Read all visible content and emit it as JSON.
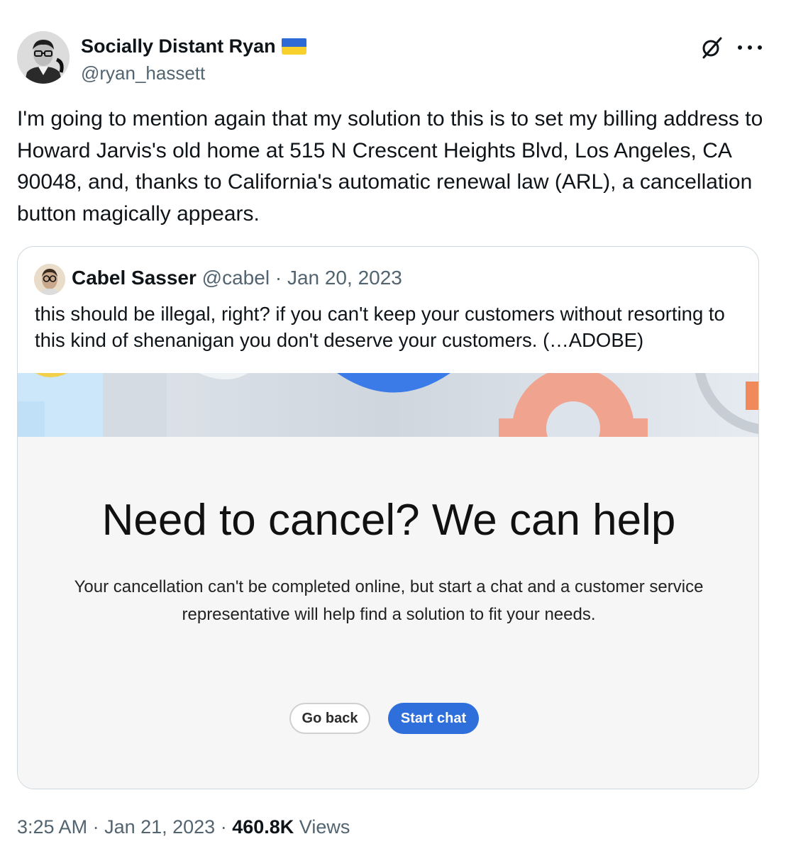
{
  "tweet": {
    "author": {
      "display_name": "Socially Distant Ryan",
      "handle": "@ryan_hassett",
      "flag_icon": "ukraine-flag-icon"
    },
    "text": "I'm going to mention again that my solution to this is to set my billing address to Howard Jarvis's old home at 515 N Crescent Heights Blvd, Los Angeles, CA 90048, and, thanks to California's automatic renewal law (ARL), a cancellation button magically appears.",
    "icons": {
      "grok": "grok-slash-icon",
      "more": "more-dots-icon"
    },
    "time": "3:25 AM",
    "separator": " · ",
    "date": "Jan 21, 2023",
    "views_count": "460.8K",
    "views_label": "Views"
  },
  "quoted_tweet": {
    "display_name": "Cabel Sasser",
    "handle": "@cabel",
    "separator": " · ",
    "date": "Jan 20, 2023",
    "text": "this should be illegal, right? if you can't keep your customers without resorting to this kind of shenanigan you don't deserve your customers. (…ADOBE)",
    "image": {
      "title": "Need to cancel? We can help",
      "description": "Your cancellation can't be completed online, but start a chat and a customer service representative will help find a solution to fit your needs.",
      "buttons": {
        "back": "Go back",
        "chat": "Start chat"
      },
      "colors": {
        "chat_button": "#2e6fdb",
        "banner_blue": "#3b7be8",
        "banner_gear": "#f0a38f",
        "banner_orange": "#f08a5a"
      }
    }
  }
}
